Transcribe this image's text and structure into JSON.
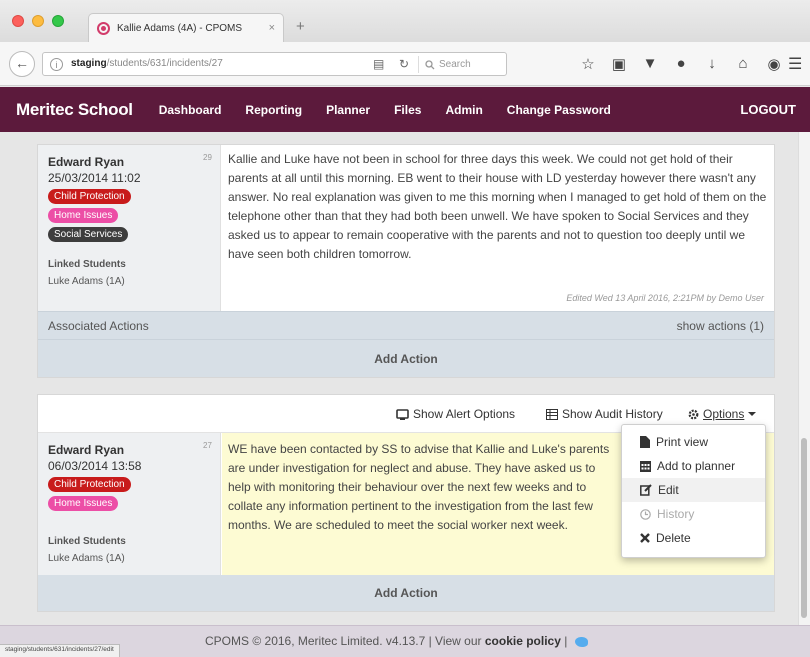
{
  "browser": {
    "tab_title": "Kallie Adams (4A) - CPOMS",
    "tab_close": "×",
    "new_tab": "+",
    "url_host": "staging",
    "url_path": "/students/631/incidents/27",
    "search_placeholder": "Search",
    "status_url": "staging/students/631/incidents/27/edit"
  },
  "site": {
    "brand": "Meritec School",
    "nav": [
      "Dashboard",
      "Reporting",
      "Planner",
      "Files",
      "Admin",
      "Change Password"
    ],
    "logout": "LOGOUT"
  },
  "incidents": [
    {
      "author": "Edward Ryan",
      "date": "25/03/2014 11:02",
      "number": "29",
      "badges": [
        "Child Protection",
        "Home Issues",
        "Social Services"
      ],
      "linked_label": "Linked Students",
      "linked_student": "Luke Adams (1A)",
      "text": "Kallie and Luke have not been in school for three days this week. We could not get hold of their parents at all until this morning. EB went to their house with LD yesterday however there wasn't any answer. No real explanation was given to me this morning when I managed to get hold of them on the telephone other than that they had both been unwell. We have spoken to Social Services and they asked us to appear to remain cooperative with the parents and not to question too deeply until we have seen both children tomorrow.",
      "edited": "Edited Wed 13 April 2016, 2:21PM by Demo User",
      "actions_label": "Associated Actions",
      "show_actions": "show actions (1)",
      "add_action": "Add Action"
    },
    {
      "author": "Edward Ryan",
      "date": "06/03/2014 13:58",
      "number": "27",
      "badges": [
        "Child Protection",
        "Home Issues"
      ],
      "linked_label": "Linked Students",
      "linked_student": "Luke Adams (1A)",
      "text": "WE have been contacted by SS to advise that Kallie and Luke's parents are under investigation for neglect and abuse. They have asked us to help with monitoring their behaviour over the next few weeks and to collate any information pertinent to the investigation from the last few months. We are scheduled to meet the social worker next week.",
      "add_action": "Add Action"
    }
  ],
  "options_bar": {
    "show_alert": "Show Alert Options",
    "show_audit": "Show Audit History",
    "options": "Options"
  },
  "options_menu": [
    "Print view",
    "Add to planner",
    "Edit",
    "History",
    "Delete"
  ],
  "footer": {
    "text": "CPOMS © 2016, Meritec Limited. v4.13.7 | View our",
    "link": "cookie policy",
    "sep": "|"
  }
}
